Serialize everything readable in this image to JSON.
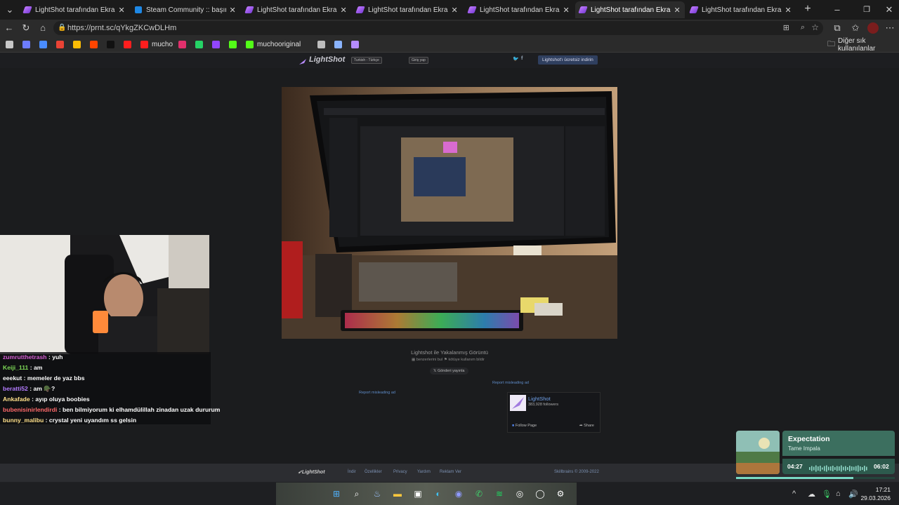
{
  "browser": {
    "tabs": [
      {
        "title": "LightShot tarafından Ekran Görünt",
        "icon": "lightshot-feather-icon",
        "active": false
      },
      {
        "title": "Steam Community :: başım ağrıyo",
        "icon": "steam-icon",
        "active": false
      },
      {
        "title": "LightShot tarafından Ekran Görünt",
        "icon": "lightshot-feather-icon",
        "active": false
      },
      {
        "title": "LightShot tarafından Ekran Görünt",
        "icon": "lightshot-feather-icon",
        "active": false
      },
      {
        "title": "LightShot tarafından Ekran Görünt",
        "icon": "lightshot-feather-icon",
        "active": false
      },
      {
        "title": "LightShot tarafından Ekran Görünt",
        "icon": "lightshot-feather-icon",
        "active": true
      },
      {
        "title": "LightShot tarafından Ekran Görünt",
        "icon": "lightshot-feather-icon",
        "active": false
      }
    ],
    "url": "https://prnt.sc/qYkgZKCwDLHm",
    "bookmarks": [
      {
        "label": "",
        "icon": "gallery-icon"
      },
      {
        "label": "",
        "icon": "globe-icon"
      },
      {
        "label": "",
        "icon": "translate-icon"
      },
      {
        "label": "",
        "icon": "gmail-icon"
      },
      {
        "label": "",
        "icon": "chrome-icon"
      },
      {
        "label": "",
        "icon": "reddit-icon"
      },
      {
        "label": "",
        "icon": "x-icon"
      },
      {
        "label": "",
        "icon": "youtube-icon"
      },
      {
        "label": "mucho",
        "icon": "youtube-icon"
      },
      {
        "label": "",
        "icon": "instagram-icon"
      },
      {
        "label": "",
        "icon": "whatsapp-icon"
      },
      {
        "label": "",
        "icon": "twitch-icon"
      },
      {
        "label": "",
        "icon": "kick-icon"
      },
      {
        "label": "muchooriginal",
        "icon": "kick-icon"
      },
      {
        "label": "",
        "icon": "discord-icon"
      },
      {
        "label": "",
        "icon": "steam-icon"
      },
      {
        "label": "",
        "icon": "lightshot-feather-icon"
      }
    ],
    "other_bookmarks": "Diğer sık kullanılanlar"
  },
  "lightshot": {
    "logo": "LightShot",
    "language": "Turkish - Türkçe",
    "login": "Giriş yap",
    "download": "Lightshot'ı ücretsiz indirin",
    "caption": "Lightshot ile Yakalanmış Görüntü",
    "sub_actions": [
      "benzerlerini bul",
      "kötüye kullanım bildir"
    ],
    "tweet": "Gönderi yayınla",
    "report_left": "Report misleading ad",
    "report_right": "Report misleading ad",
    "fb": {
      "name": "LightShot",
      "followers": "383,928 followers",
      "follow": "Follow Page",
      "share": "Share"
    },
    "footer": {
      "logo": "LightShot",
      "links": [
        "İndir",
        "Özellikler",
        "Privacy",
        "Yardım",
        "Reklam Ver"
      ],
      "copyright": "Skillbrains © 2009-2022"
    }
  },
  "chat": [
    {
      "user": "zumrutthetrash",
      "text": " : yuh",
      "color": "#d55fd3"
    },
    {
      "user": "Keiji_111",
      "text": " : am",
      "color": "#7ed957"
    },
    {
      "user": "eeekut",
      "text": " : memeler de yaz bbs",
      "color": "#ffffff"
    },
    {
      "user": "beratti52",
      "text": " : am 🪖?",
      "color": "#b47cff"
    },
    {
      "user": "Ankafade",
      "text": " : ayıp oluya boobies",
      "color": "#ffe08a"
    },
    {
      "user": "bubenisinirlendirdi",
      "text": " : ben bilmiyorum ki elhamdülillah zinadan uzak dururum",
      "color": "#ff6a6a"
    },
    {
      "user": "bunny_malibu",
      "text": " : crystal yeni uyandım ss gelsin",
      "color": "#ffe08a"
    }
  ],
  "music": {
    "title": "Expectation",
    "artist": "Tame Impala",
    "elapsed": "04:27",
    "duration": "06:02",
    "progress": 0.74
  },
  "taskbar": {
    "time": "17:21",
    "date": "29.03.2026"
  },
  "colors": {
    "accent": "#78d9c4",
    "link": "#5f8cc9"
  }
}
